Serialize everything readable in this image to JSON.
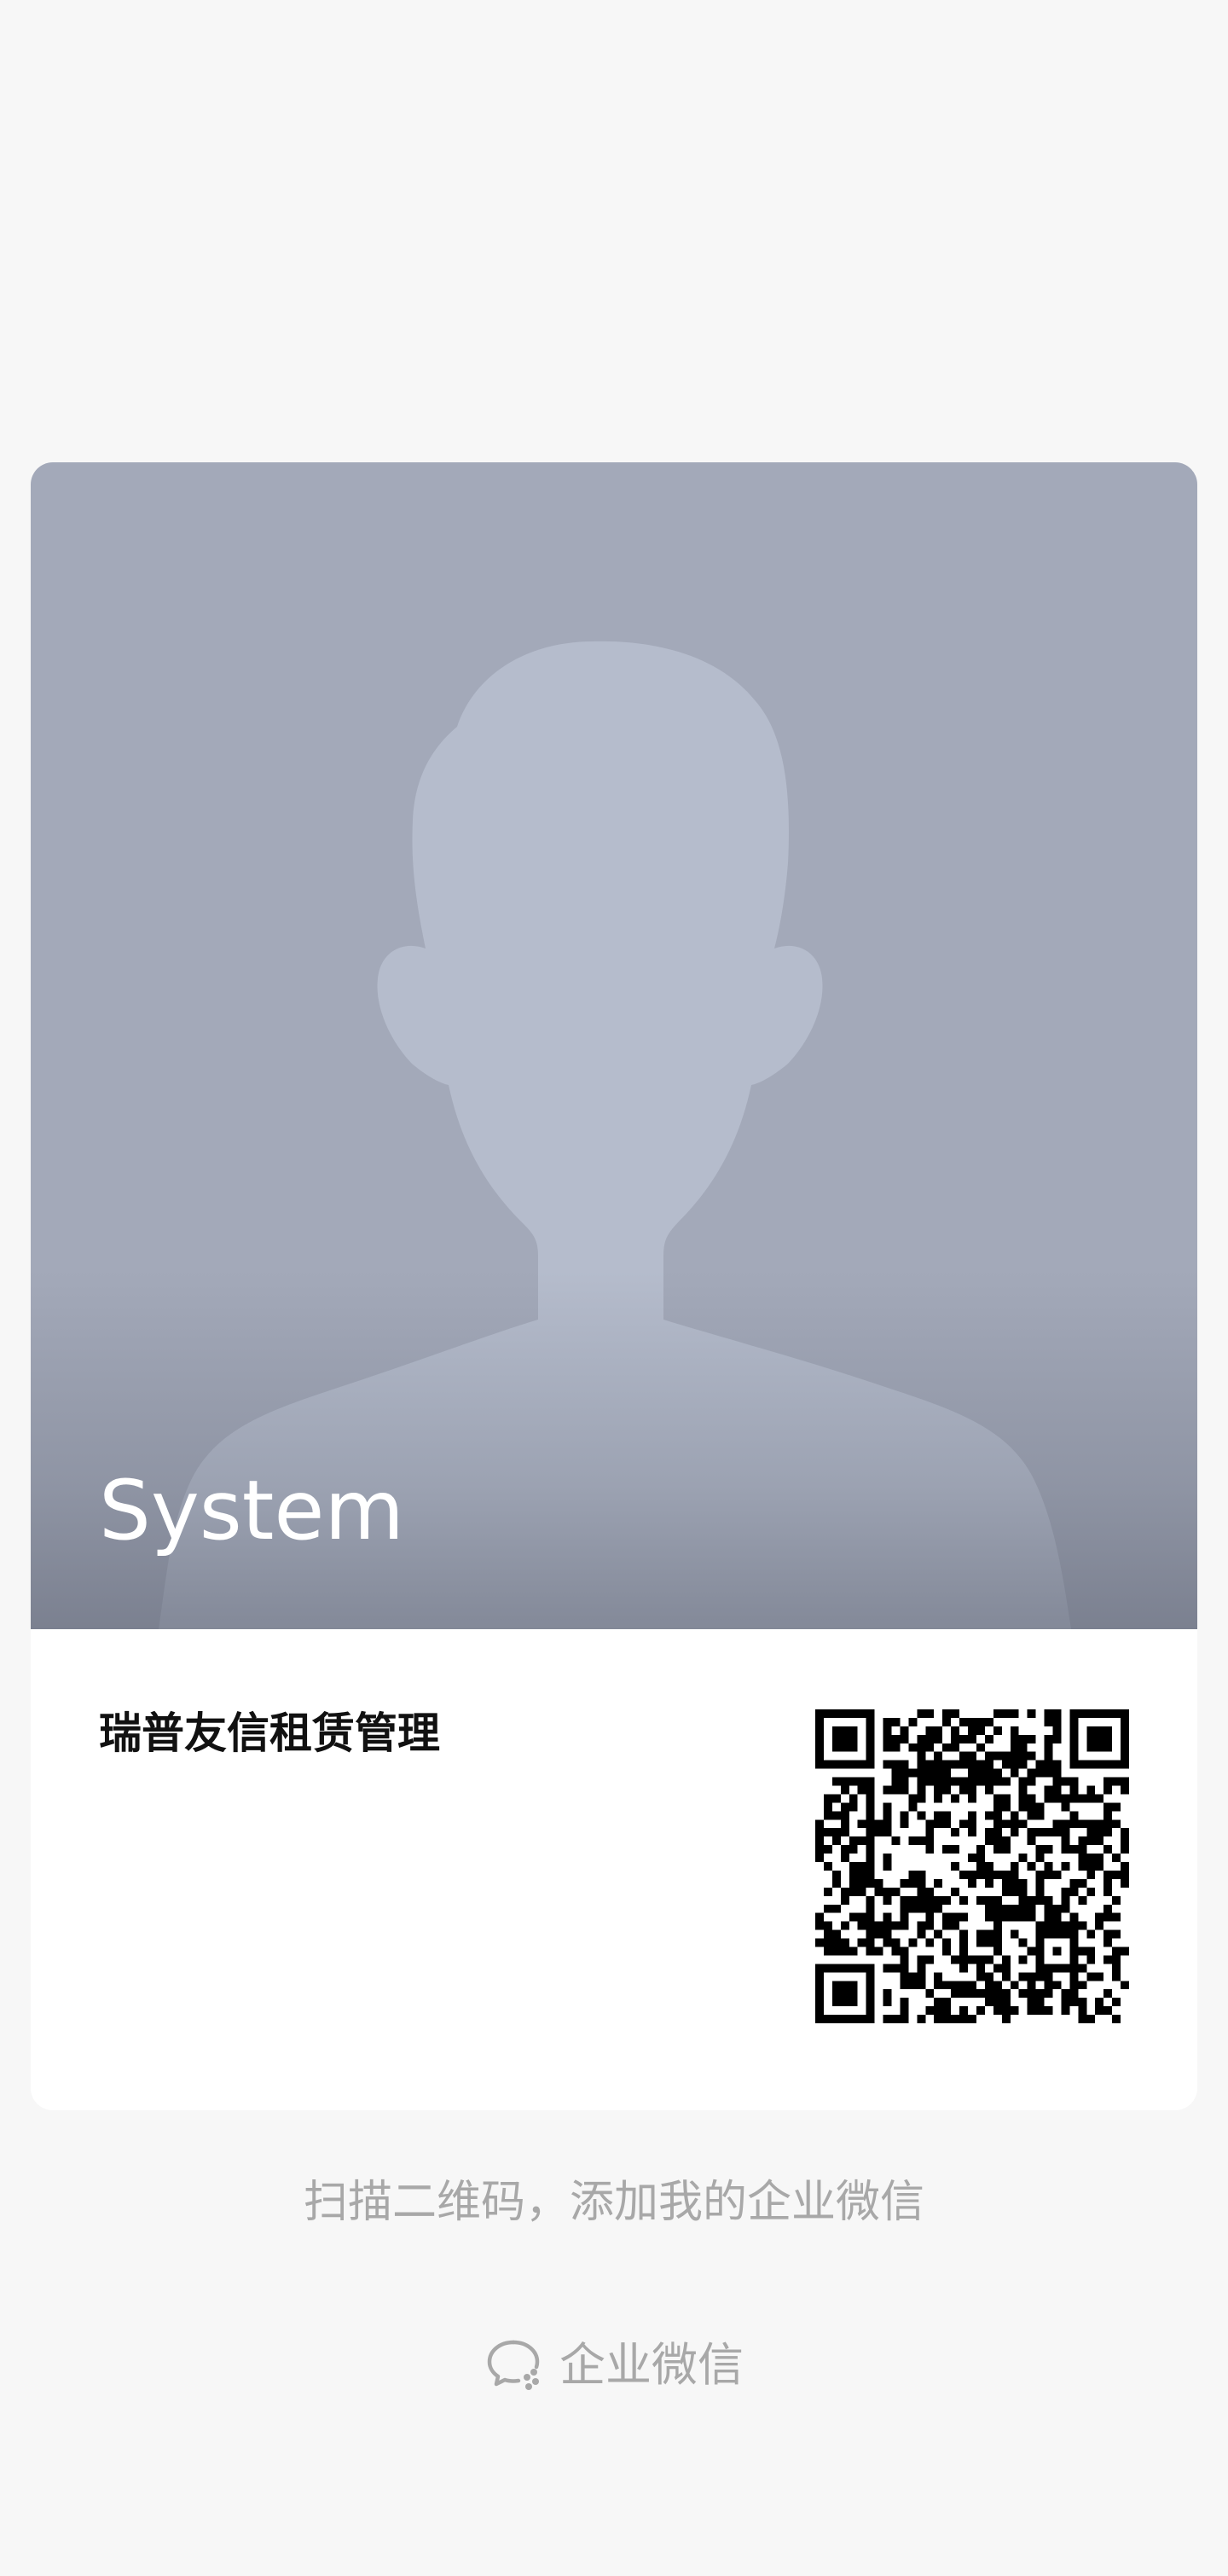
{
  "card": {
    "name": "System",
    "company": "瑞普友信租赁管理",
    "avatar_icon": "person-silhouette-icon",
    "qr_icon": "qr-code-icon"
  },
  "hint": "扫描二维码，添加我的企业微信",
  "brand": {
    "icon": "wecom-chat-icon",
    "label": "企业微信"
  },
  "colors": {
    "page_background": "#f7f7f7",
    "photo_background": "#a3a9b9",
    "silhouette": "#b5bccc",
    "muted_text": "#a8a8a8"
  }
}
